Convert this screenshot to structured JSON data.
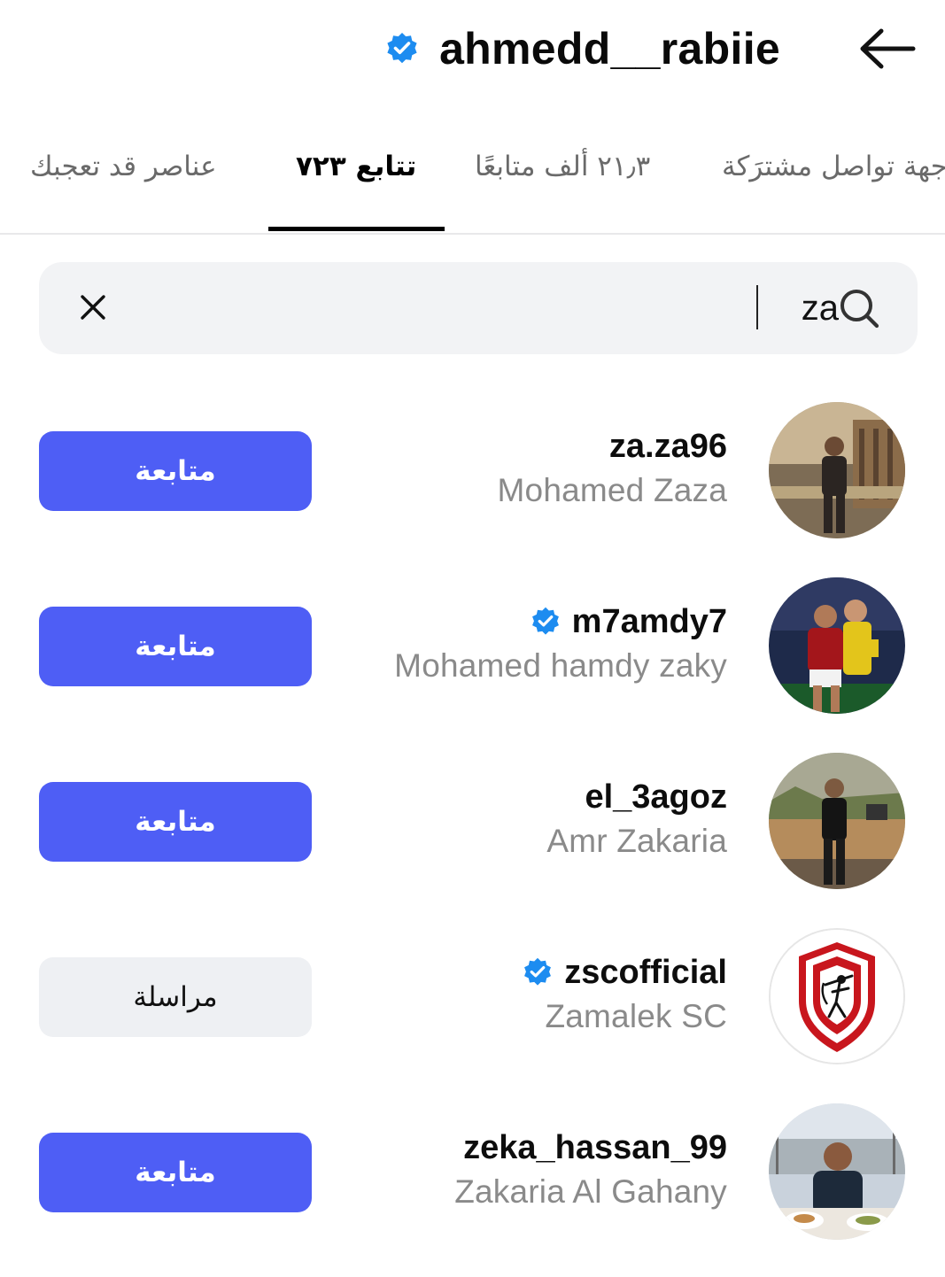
{
  "header": {
    "title": "ahmedd__rabiie",
    "verified_icon": "verified-badge-icon",
    "back_icon": "arrow-left-icon"
  },
  "tabs": [
    {
      "label": "عناصر قد تعجبك",
      "active": false
    },
    {
      "label": "تتابع ٧٢٣",
      "active": true
    },
    {
      "label": "٢١٫٣ ألف متابعًا",
      "active": false
    },
    {
      "label": "جهة تواصل مشترَكة",
      "active": false
    }
  ],
  "search": {
    "value": "za",
    "icon": "search-icon",
    "clear_icon": "close-icon"
  },
  "colors": {
    "primary_button": "#4e5ef5",
    "secondary_button": "#eef0f3",
    "verified": "#1d8cf0",
    "subtitle": "#8a8a8a"
  },
  "users": [
    {
      "username": "za.za96",
      "full_name": "Mohamed Zaza",
      "verified": false,
      "button": "متابعة",
      "button_style": "primary"
    },
    {
      "username": "m7amdy7",
      "full_name": "Mohamed hamdy zaky",
      "verified": true,
      "button": "متابعة",
      "button_style": "primary"
    },
    {
      "username": "el_3agoz",
      "full_name": "Amr Zakaria",
      "verified": false,
      "button": "متابعة",
      "button_style": "primary"
    },
    {
      "username": "zscofficial",
      "full_name": "Zamalek SC",
      "verified": true,
      "button": "مراسلة",
      "button_style": "secondary"
    },
    {
      "username": "zeka_hassan_99",
      "full_name": "Zakaria Al Gahany",
      "verified": false,
      "button": "متابعة",
      "button_style": "primary"
    }
  ]
}
